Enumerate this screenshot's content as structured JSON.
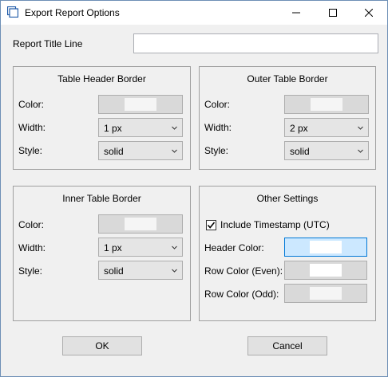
{
  "window": {
    "title": "Export Report Options"
  },
  "report_title": {
    "label": "Report Title Line",
    "value": ""
  },
  "groups": {
    "header_border": {
      "title": "Table Header Border",
      "color_label": "Color:",
      "width_label": "Width:",
      "width_value": "1 px",
      "style_label": "Style:",
      "style_value": "solid"
    },
    "outer_border": {
      "title": "Outer Table Border",
      "color_label": "Color:",
      "width_label": "Width:",
      "width_value": "2 px",
      "style_label": "Style:",
      "style_value": "solid"
    },
    "inner_border": {
      "title": "Inner Table Border",
      "color_label": "Color:",
      "width_label": "Width:",
      "width_value": "1 px",
      "style_label": "Style:",
      "style_value": "solid"
    },
    "other": {
      "title": "Other Settings",
      "timestamp_label": "Include Timestamp (UTC)",
      "timestamp_checked": true,
      "header_color_label": "Header Color:",
      "row_even_label": "Row Color (Even):",
      "row_odd_label": "Row Color (Odd):"
    }
  },
  "buttons": {
    "ok": "OK",
    "cancel": "Cancel"
  },
  "colors": {
    "selection": "#cce8ff",
    "accent": "#0078d7"
  }
}
